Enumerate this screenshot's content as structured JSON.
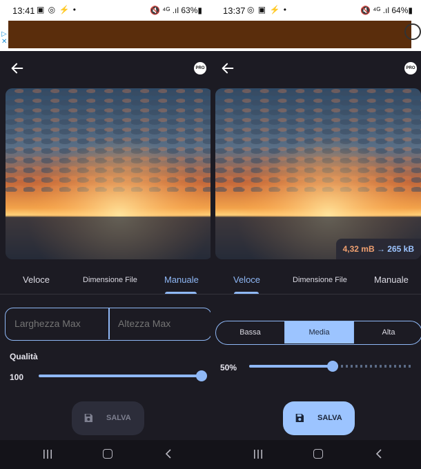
{
  "left": {
    "status": {
      "time": "13:41",
      "icons": "▣ ◎ ⚡ •",
      "right": "🔇 ⁴ᴳ .ıl 63%▮"
    },
    "tabs": [
      {
        "label": "Veloce",
        "active": false
      },
      {
        "label": "Dimensione File",
        "active": false
      },
      {
        "label": "Manuale",
        "active": true
      }
    ],
    "width_placeholder": "Larghezza Max",
    "height_placeholder": "Altezza Max",
    "quality_label": "Qualità",
    "quality_value": "100",
    "quality_fraction": 1.0,
    "save_label": "SALVA",
    "pro_label": "PRO"
  },
  "right": {
    "status": {
      "time": "13:37",
      "icons": "◎ ▣ ⚡ •",
      "right": "🔇 ⁴ᴳ .ıl 64%▮"
    },
    "tabs": [
      {
        "label": "Veloce",
        "active": true
      },
      {
        "label": "Dimensione File",
        "active": false
      },
      {
        "label": "Manuale",
        "active": false
      }
    ],
    "size_original": "4,32 mB",
    "size_arrow": "→",
    "size_compressed": "265 kB",
    "quality_options": [
      {
        "label": "Bassa",
        "selected": false
      },
      {
        "label": "Media",
        "selected": true
      },
      {
        "label": "Alta",
        "selected": false
      }
    ],
    "quality_value": "50%",
    "quality_fraction": 0.5,
    "save_label": "SALVA",
    "pro_label": "PRO"
  },
  "colors": {
    "accent": "#8fb8f6",
    "accent_fill": "#9cc4ff",
    "background": "#1c1b23",
    "ad": "#5a2d0c"
  },
  "icons": [
    "back-arrow-icon",
    "pro-badge-icon",
    "save-floppy-icon",
    "recents-icon",
    "home-icon",
    "nav-back-icon"
  ]
}
